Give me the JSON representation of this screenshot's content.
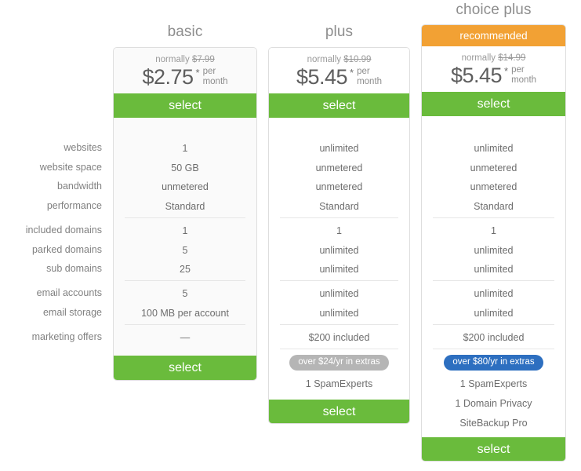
{
  "feature_labels": [
    "websites",
    "website space",
    "bandwidth",
    "performance",
    "included domains",
    "parked domains",
    "sub domains",
    "email accounts",
    "email storage",
    "marketing offers"
  ],
  "colors": {
    "green": "#6abb3c",
    "green_light": "#7dc63f",
    "orange": "#f2a134",
    "blue": "#2d6fc0",
    "gray_pill": "#b5b5b5",
    "text": "#6d6d6d",
    "label_text": "#818181",
    "title_text": "#8d8d8d",
    "border": "#dedede",
    "divider": "#e6e6e6",
    "card_bg_basic": "#fafafa",
    "card_bg": "#ffffff"
  },
  "plans": [
    {
      "id": "basic",
      "title": "basic",
      "ribbon": null,
      "normally_prefix": "normally",
      "normally_price": "$7.99",
      "price": "$2.75",
      "price_currency": "$",
      "price_amount": "2.75",
      "asterisk": "*",
      "per_line1": "per",
      "per_line2": "month",
      "select_label": "select",
      "bottom_select_label": "select",
      "features": [
        "1",
        "50 GB",
        "unmetered",
        "Standard",
        "1",
        "5",
        "25",
        "5",
        "100 MB per account",
        "—"
      ],
      "extras_pill": null,
      "extras_items": []
    },
    {
      "id": "plus",
      "title": "plus",
      "ribbon": null,
      "normally_prefix": "normally",
      "normally_price": "$10.99",
      "price": "$5.45",
      "price_currency": "$",
      "price_amount": "5.45",
      "asterisk": "*",
      "per_line1": "per",
      "per_line2": "month",
      "select_label": "select",
      "bottom_select_label": "select",
      "features": [
        "unlimited",
        "unmetered",
        "unmetered",
        "Standard",
        "1",
        "unlimited",
        "unlimited",
        "unlimited",
        "unlimited",
        "$200 included"
      ],
      "extras_pill": "over $24/yr in extras",
      "extras_items": [
        "1 SpamExperts"
      ]
    },
    {
      "id": "choice-plus",
      "title": "choice plus",
      "ribbon": "recommended",
      "normally_prefix": "normally",
      "normally_price": "$14.99",
      "price": "$5.45",
      "price_currency": "$",
      "price_amount": "5.45",
      "asterisk": "*",
      "per_line1": "per",
      "per_line2": "month",
      "select_label": "select",
      "bottom_select_label": "select",
      "features": [
        "unlimited",
        "unmetered",
        "unmetered",
        "Standard",
        "1",
        "unlimited",
        "unlimited",
        "unlimited",
        "unlimited",
        "$200 included"
      ],
      "extras_pill": "over $80/yr in extras",
      "extras_items": [
        "1 SpamExperts",
        "1 Domain Privacy",
        "SiteBackup Pro"
      ]
    }
  ]
}
